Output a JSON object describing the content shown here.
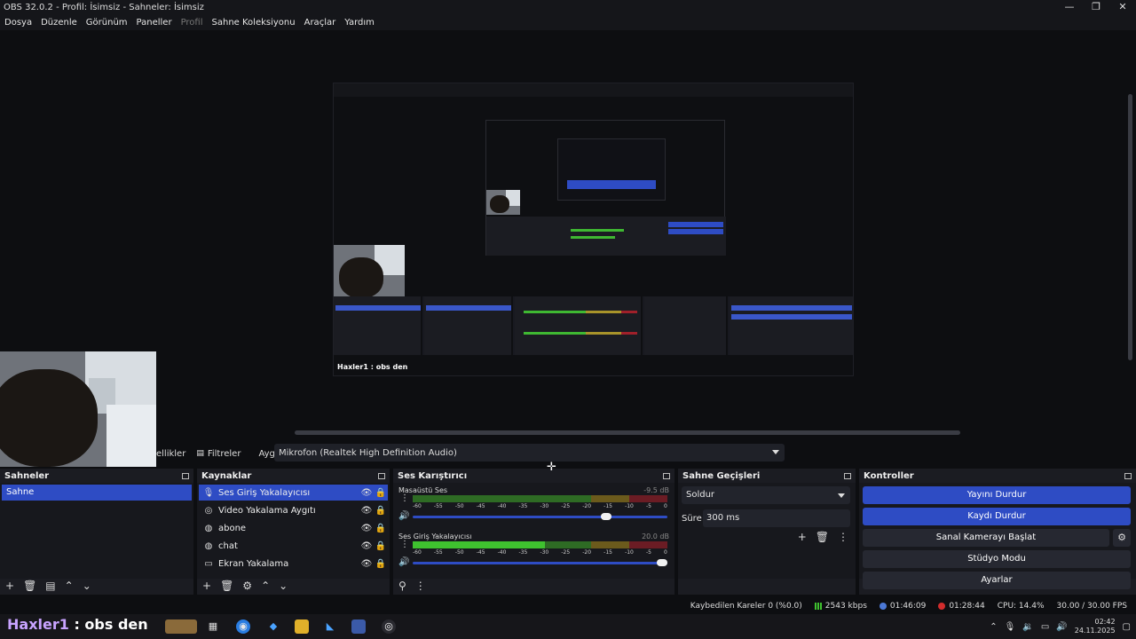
{
  "window": {
    "title": "OBS 32.0.2 - Profil: İsimsiz - Sahneler: İsimsiz",
    "controls": [
      "—",
      "❐",
      "✕"
    ]
  },
  "menu": [
    {
      "label": "Dosya"
    },
    {
      "label": "Düzenle"
    },
    {
      "label": "Görünüm"
    },
    {
      "label": "Paneller"
    },
    {
      "label": "Profil",
      "disabled": true
    },
    {
      "label": "Sahne Koleksiyonu"
    },
    {
      "label": "Araçlar"
    },
    {
      "label": "Yardım"
    }
  ],
  "preview": {
    "nested_overlay_text": "Haxler1 : obs den"
  },
  "propbar": {
    "props_label": "Özellikler",
    "props_visible": "ellikler",
    "filters_label": "Filtreler",
    "device_label": "Aygıt",
    "device_value": "Mikrofon (Realtek High Definition Audio)"
  },
  "scenes": {
    "title": "Sahneler",
    "items": [
      {
        "label": "Sahne",
        "selected": true
      }
    ]
  },
  "sources": {
    "title": "Kaynaklar",
    "items": [
      {
        "label": "Ses Giriş Yakalayıcısı",
        "icon": "mic-icon",
        "selected": true
      },
      {
        "label": "Video Yakalama Aygıtı",
        "icon": "camera-icon"
      },
      {
        "label": "abone",
        "icon": "browser-icon"
      },
      {
        "label": "chat",
        "icon": "browser-icon"
      },
      {
        "label": "Ekran Yakalama",
        "icon": "monitor-icon"
      }
    ]
  },
  "mixer": {
    "title": "Ses Karıştırıcı",
    "channels": [
      {
        "name": "Masaüstü Ses",
        "db": "-9.5 dB",
        "level": 0,
        "volume": 0.78
      },
      {
        "name": "Ses Giriş Yakalayıcısı",
        "db": "20.0 dB",
        "level": 0.52,
        "volume": 1.0
      }
    ],
    "ticks": [
      "-60",
      "-55",
      "-50",
      "-45",
      "-40",
      "-35",
      "-30",
      "-25",
      "-20",
      "-15",
      "-10",
      "-5",
      "0"
    ]
  },
  "transitions": {
    "title": "Sahne Geçişleri",
    "selected": "Soldur",
    "duration_label": "Süre",
    "duration_value": "300 ms"
  },
  "controls": {
    "title": "Kontroller",
    "buttons": [
      {
        "label": "Yayını Durdur",
        "active": true
      },
      {
        "label": "Kaydı Durdur",
        "active": true
      },
      {
        "label": "Sanal Kamerayı Başlat",
        "active": false
      },
      {
        "label": "Stüdyo Modu",
        "active": false
      },
      {
        "label": "Ayarlar",
        "active": false
      }
    ]
  },
  "status": {
    "dropped_frames": "Kaybedilen Kareler 0 (%0.0)",
    "bitrate": "2543 kbps",
    "stream_time": "01:46:09",
    "record_time": "01:28:44",
    "cpu": "CPU: 14.4%",
    "fps": "30.00 / 30.00 FPS"
  },
  "taskbar": {
    "overlay_user": "Haxler1",
    "overlay_msg": " : obs den",
    "time": "02:42",
    "date": "24.11.2025"
  }
}
